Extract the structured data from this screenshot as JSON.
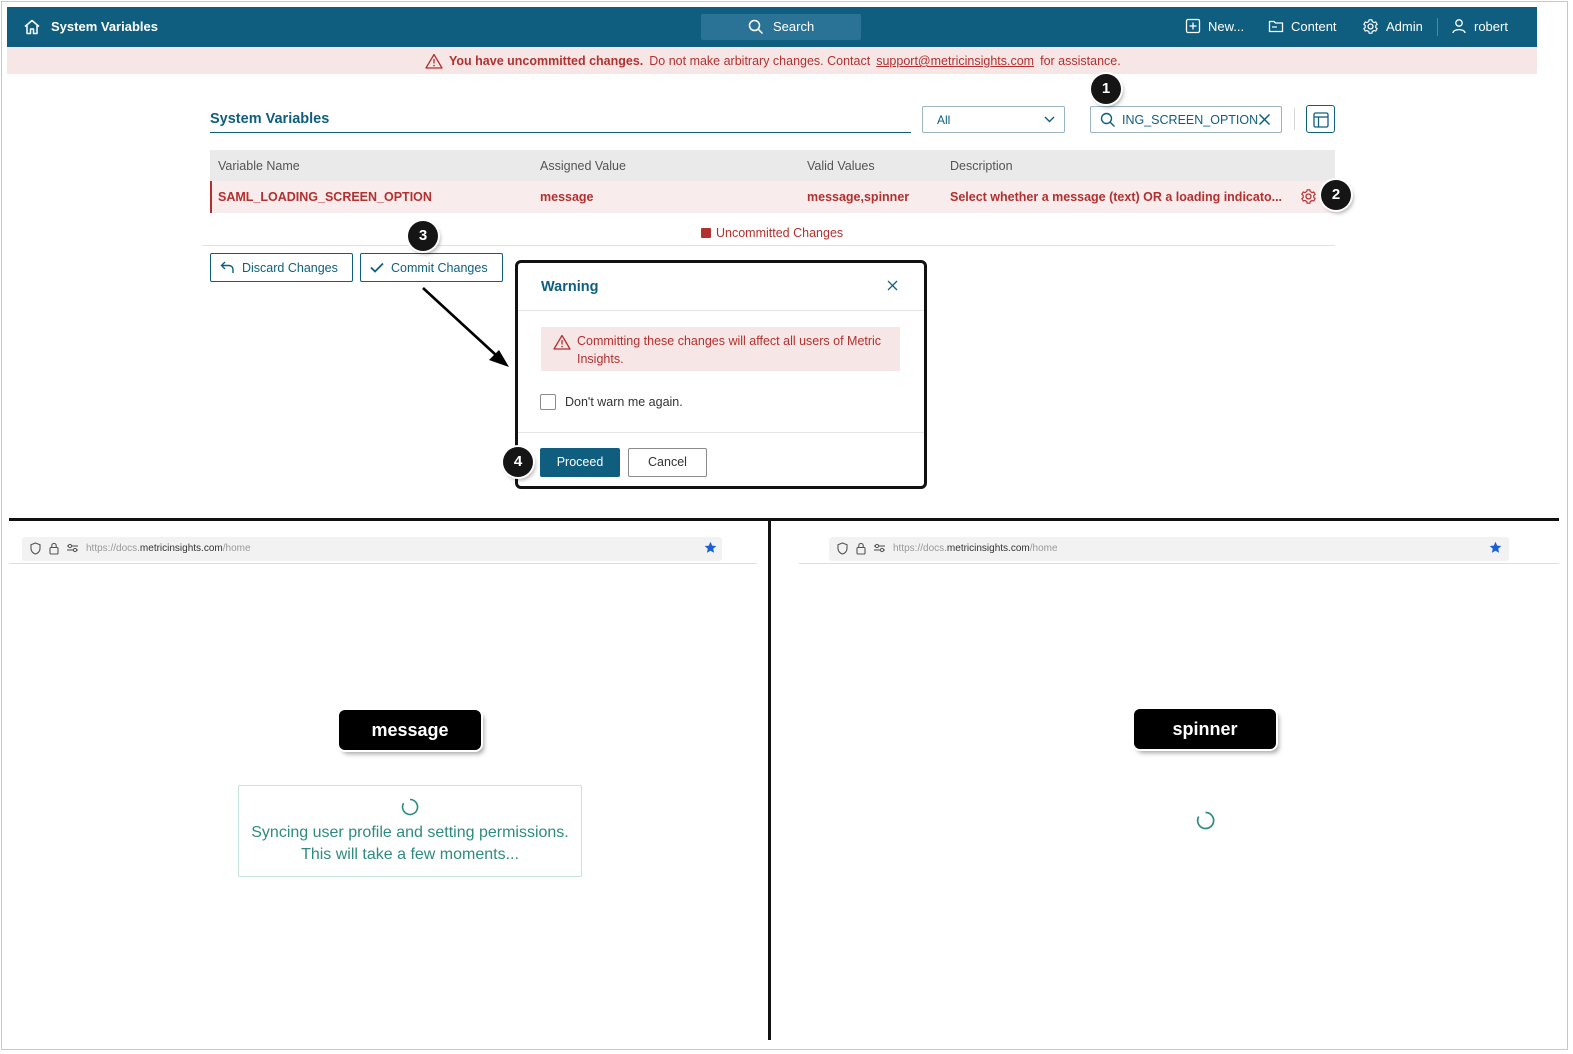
{
  "app": {
    "title": "System Variables",
    "search_label": "Search",
    "nav": [
      "New...",
      "Content",
      "Admin",
      "robert"
    ]
  },
  "banner": {
    "bold": "You have uncommitted changes.",
    "text_before": "Do not make arbitrary changes. Contact",
    "email": "support@metricinsights.com",
    "text_after": "for assistance."
  },
  "page": {
    "title": "System Variables",
    "filter_value": "All",
    "search_value": "ING_SCREEN_OPTION"
  },
  "table": {
    "headers": [
      "Variable Name",
      "Assigned Value",
      "Valid Values",
      "Description"
    ],
    "row": {
      "name": "SAML_LOADING_SCREEN_OPTION",
      "assigned": "message",
      "valid": "message,spinner",
      "description": "Select whether a message (text) OR a loading indicato..."
    },
    "legend": "Uncommitted Changes"
  },
  "actions": {
    "discard": "Discard Changes",
    "commit": "Commit Changes"
  },
  "dialog": {
    "title": "Warning",
    "warning_text": "Committing these changes will affect all users of Metric Insights.",
    "checkbox_label": "Don't warn me again.",
    "proceed": "Proceed",
    "cancel": "Cancel"
  },
  "badges": [
    "1",
    "2",
    "3",
    "4"
  ],
  "browser": {
    "url_prefix": "https://docs.",
    "url_domain": "metricinsights.com",
    "url_path": "/home"
  },
  "left_panel": {
    "label": "message",
    "line1": "Syncing user profile and setting permissions.",
    "line2": "This will take a few moments..."
  },
  "right_panel": {
    "label": "spinner"
  },
  "colors": {
    "primary": "#0f5e80",
    "error": "#b2302f",
    "banner_bg": "#f6e7e6",
    "sync_text": "#2e8b7f"
  }
}
